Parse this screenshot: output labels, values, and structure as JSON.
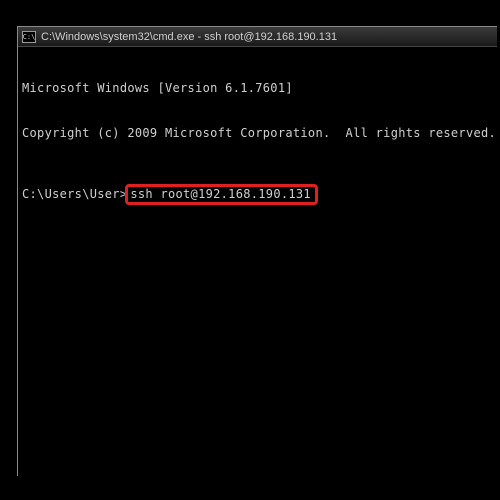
{
  "titlebar": {
    "icon_label": "C:\\",
    "text": "C:\\Windows\\system32\\cmd.exe - ssh  root@192.168.190.131"
  },
  "terminal": {
    "line1": "Microsoft Windows [Version 6.1.7601]",
    "line2": "Copyright (c) 2009 Microsoft Corporation.  All rights reserved.",
    "prompt_prefix": "C:\\Users\\User>",
    "command": "ssh root@192.168.190.131"
  },
  "highlight": {
    "color": "#e02020"
  }
}
